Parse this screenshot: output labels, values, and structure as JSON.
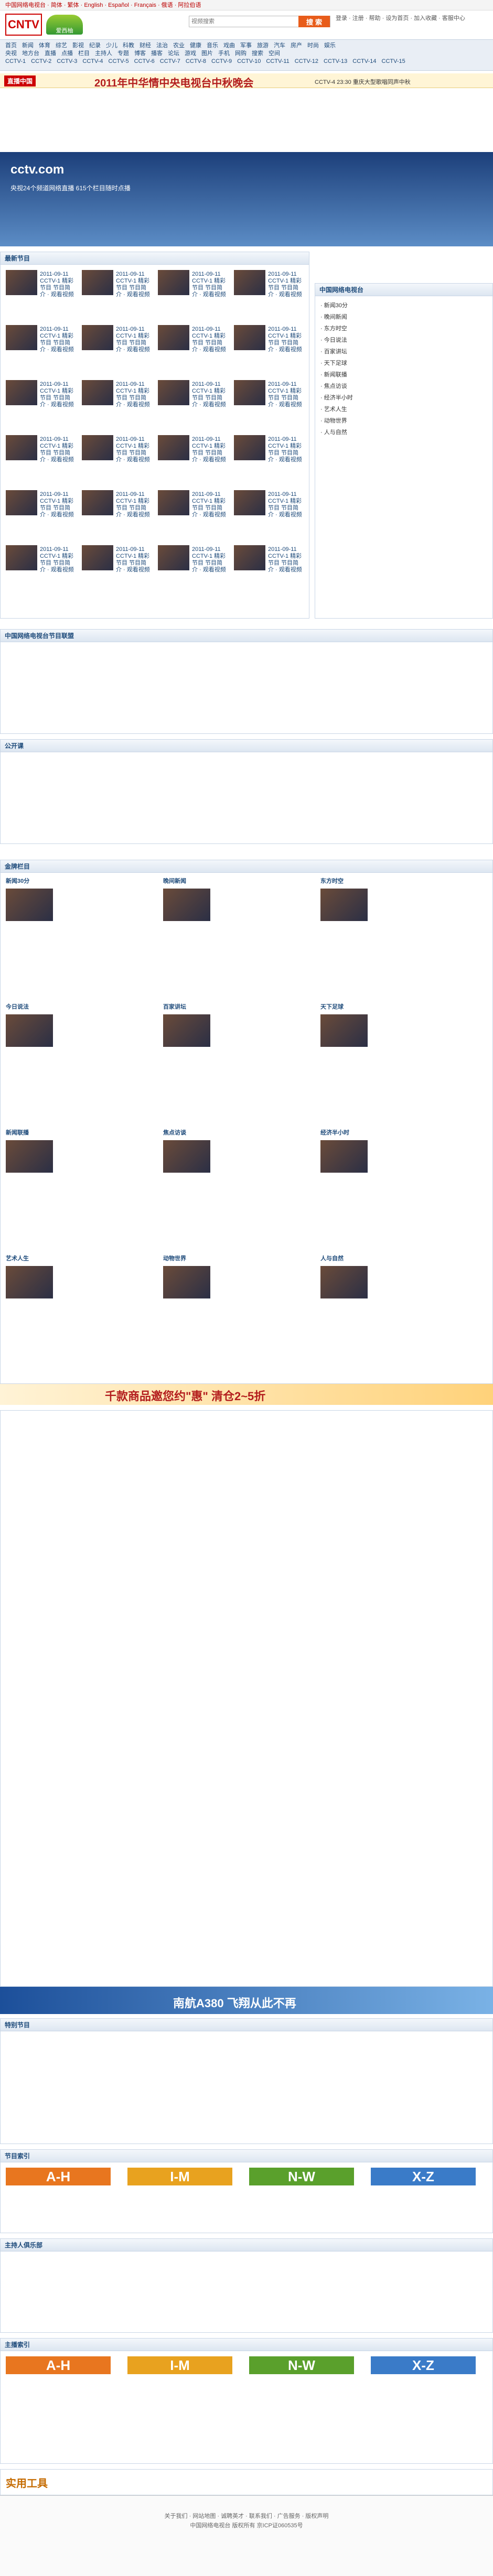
{
  "topbar": {
    "text": "中国网络电视台 · 简体 · 繁体 · English · Español · Français · 俄语 · 阿拉伯语"
  },
  "header": {
    "logo": "CNTV",
    "logo_sub": "中国网络电视台",
    "site2": "爱西柚",
    "search_placeholder": "视频搜索",
    "search_btn": "搜 索",
    "links": "登录 · 注册 · 帮助 · 设为首页 · 加入收藏 · 客服中心"
  },
  "nav": {
    "row1": [
      "首页",
      "新闻",
      "体育",
      "综艺",
      "影视",
      "纪录",
      "少儿",
      "科教",
      "财经",
      "法治",
      "农业",
      "健康",
      "音乐",
      "戏曲",
      "军事",
      "旅游",
      "汽车",
      "房产",
      "时尚",
      "娱乐"
    ],
    "row2": [
      "央视",
      "地方台",
      "直播",
      "点播",
      "栏目",
      "主持人",
      "专题",
      "博客",
      "播客",
      "论坛",
      "游戏",
      "图片",
      "手机",
      "网购",
      "搜索",
      "空间"
    ],
    "row3": [
      "CCTV-1",
      "CCTV-2",
      "CCTV-3",
      "CCTV-4",
      "CCTV-5",
      "CCTV-6",
      "CCTV-7",
      "CCTV-8",
      "CCTV-9",
      "CCTV-10",
      "CCTV-11",
      "CCTV-12",
      "CCTV-13",
      "CCTV-14",
      "CCTV-15"
    ]
  },
  "live": {
    "label": "直播中国",
    "title": "2011年中华情中央电视台中秋晚会",
    "sub": "CCTV-4 23:30 重庆大型歌唱同声中秋"
  },
  "cctv": {
    "brand": "cctv.com",
    "slogan": "央视24个频道网络直播 615个栏目随时点播"
  },
  "sections": {
    "latest": "最新节目",
    "china": "中国网络电视台",
    "jointly": "中国网络电视台节目联盟",
    "public": "公开课",
    "selected": "金牌栏目",
    "special": "特别节目",
    "index": "节目索引",
    "host": "主持人俱乐部",
    "hosts": "主播索引",
    "tools": "实用工具"
  },
  "letters": [
    "A-H",
    "I-M",
    "N-W",
    "X-Z"
  ],
  "banners": {
    "sale": "千款商品邀您约\"惠\" 清仓2~5折",
    "air": "南航A380 飞翔从此不再"
  },
  "columns": [
    "新闻30分",
    "晚间新闻",
    "东方时空",
    "今日说法",
    "百家讲坛",
    "天下足球",
    "新闻联播",
    "焦点访谈",
    "经济半小时",
    "艺术人生",
    "动物世界",
    "人与自然"
  ],
  "clip": "2011-09-11 CCTV-1 精彩节目 节目简介 · 观看视频",
  "footer": {
    "line1": "关于我们 · 网站地图 · 诚聘英才 · 联系我们 · 广告服务 · 版权声明",
    "line2": "中国网络电视台 版权所有 京ICP证060535号"
  }
}
